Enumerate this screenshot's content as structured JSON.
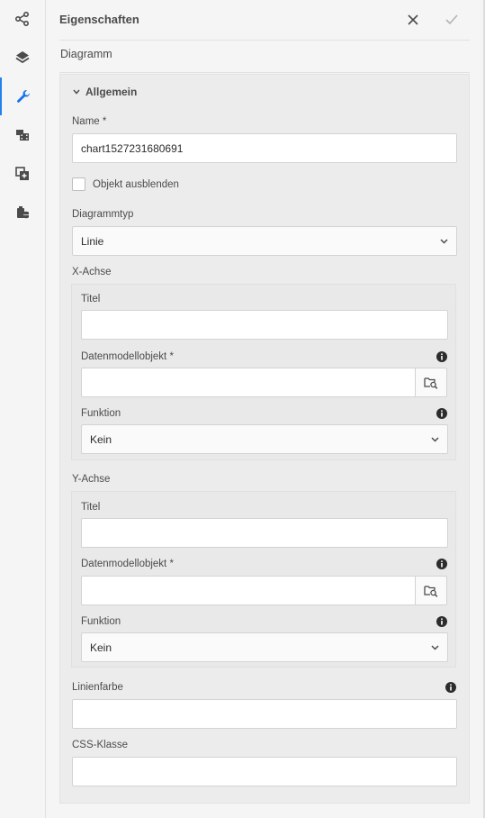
{
  "rail": {
    "items": [
      {
        "icon": "share-icon"
      },
      {
        "icon": "layers-icon"
      },
      {
        "icon": "wrench-icon",
        "active": true
      },
      {
        "icon": "film-icon"
      },
      {
        "icon": "add-panel-icon"
      },
      {
        "icon": "database-icon"
      }
    ],
    "accent_color": "#2680eb"
  },
  "header": {
    "title": "Eigenschaften",
    "close_icon": "close-icon",
    "confirm_icon": "checkmark-icon"
  },
  "component": {
    "title": "Diagramm"
  },
  "section": {
    "title": "Allgemein",
    "name": {
      "label": "Name *",
      "value": "chart1527231680691"
    },
    "hide_object": {
      "label": "Objekt ausblenden",
      "checked": false
    },
    "chart_type": {
      "label": "Diagrammtyp",
      "value": "Linie"
    },
    "x_axis": {
      "label": "X-Achse",
      "title_label": "Titel",
      "title_value": "",
      "data_model_label": "Datenmodellobjekt *",
      "data_model_value": "",
      "function_label": "Funktion",
      "function_value": "Kein"
    },
    "y_axis": {
      "label": "Y-Achse",
      "title_label": "Titel",
      "title_value": "",
      "data_model_label": "Datenmodellobjekt *",
      "data_model_value": "",
      "function_label": "Funktion",
      "function_value": "Kein"
    },
    "line_color": {
      "label": "Linienfarbe",
      "value": ""
    },
    "css_class": {
      "label": "CSS-Klasse",
      "value": ""
    }
  }
}
